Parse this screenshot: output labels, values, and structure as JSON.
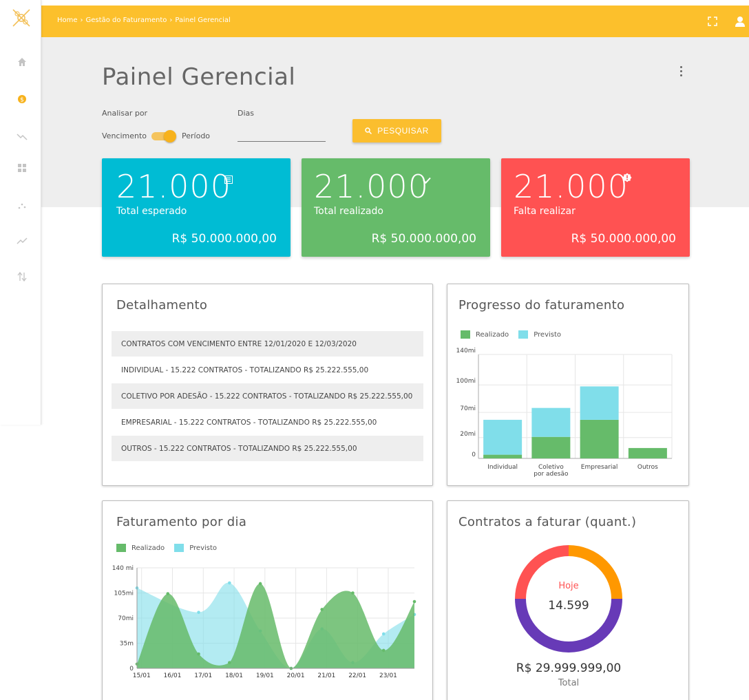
{
  "breadcrumb": [
    "Home",
    "Gestão do Faturamento",
    "Painel Gerencial"
  ],
  "page_title": "Painel Gerencial",
  "filters": {
    "analisar_label": "Analisar por",
    "dias_label": "Dias",
    "toggle_left": "Vencimento",
    "toggle_right": "Período",
    "toggle_on": true,
    "dias_value": "",
    "search_button": "PESQUISAR"
  },
  "stats": [
    {
      "value": "21.000",
      "label": "Total esperado",
      "amount": "R$ 50.000.000,00",
      "color": "#00bcd4",
      "icon": "list-icon"
    },
    {
      "value": "21.000",
      "label": "Total realizado",
      "amount": "R$ 50.000.000,00",
      "color": "#66bb6a",
      "icon": "check-icon"
    },
    {
      "value": "21.000",
      "label": "Falta realizar",
      "amount": "R$ 50.000.000,00",
      "color": "#ff5252",
      "icon": "alert-icon"
    }
  ],
  "detalhamento": {
    "title": "Detalhamento",
    "rows": [
      "CONTRATOS COM VENCIMENTO ENTRE 12/01/2020 E 12/03/2020",
      "INDIVIDUAL - 15.222 CONTRATOS  - TOTALIZANDO R$ 25.222.555,00",
      "COLETIVO POR ADESÃO  - 15.222 CONTRATOS  - TOTALIZANDO R$ 25.222.555,00",
      "EMPRESARIAL  - 15.222 CONTRATOS  - TOTALIZANDO R$ 25.222.555,00",
      "OUTROS  - 15.222 CONTRATOS  - TOTALIZANDO R$ 25.222.555,00"
    ]
  },
  "progresso": {
    "title": "Progresso do faturamento"
  },
  "faturamento_dia": {
    "title": "Faturamento por dia"
  },
  "contratos": {
    "title": "Contratos a faturar (quant.)",
    "center_label": "Hoje",
    "center_value": "14.599",
    "total_value": "R$ 29.999.999,00",
    "total_label": "Total"
  },
  "legend": {
    "realizado": "Realizado",
    "previsto": "Previsto"
  },
  "colors": {
    "realizado": "#66bb6a",
    "previsto": "#80deea",
    "accent": "#fcc02c"
  },
  "chart_data": [
    {
      "type": "bar",
      "stacked": true,
      "title": "Progresso do faturamento",
      "categories": [
        "Individual",
        "Coletivo\npor adesão",
        "Empresarial",
        "Outros"
      ],
      "series": [
        {
          "name": "Realizado",
          "color": "#66bb6a",
          "values": [
            5,
            29,
            52,
            14
          ]
        },
        {
          "name": "Previsto",
          "color": "#80deea",
          "values": [
            47,
            39,
            45,
            0
          ]
        }
      ],
      "yticks": [
        {
          "value": 0,
          "label": "0"
        },
        {
          "value": 28,
          "label": "20mi"
        },
        {
          "value": 62,
          "label": "70mi"
        },
        {
          "value": 99,
          "label": "100mi"
        },
        {
          "value": 140,
          "label": "140mi"
        }
      ],
      "ylim": [
        0,
        140
      ],
      "legend": "top-left",
      "grid": true
    },
    {
      "type": "area",
      "title": "Faturamento por dia",
      "x": [
        "15/01",
        "16/01",
        "17/01",
        "18/01",
        "19/01",
        "20/01",
        "21/01",
        "22/01",
        "23/01"
      ],
      "series": [
        {
          "name": "Realizado",
          "color": "#66bb6a",
          "x": [
            0,
            1,
            2,
            3,
            4,
            5,
            6,
            7,
            8,
            9
          ],
          "values": [
            6,
            104,
            20,
            8,
            118,
            0,
            82,
            105,
            25,
            93
          ]
        },
        {
          "name": "Previsto",
          "color": "#80deea",
          "x": [
            0,
            2,
            3,
            4,
            5,
            6,
            7,
            8,
            9
          ],
          "values": [
            112,
            78,
            119,
            52,
            0,
            55,
            8,
            48,
            75
          ]
        }
      ],
      "yticks": [
        {
          "value": 0,
          "label": "0"
        },
        {
          "value": 35,
          "label": "35m"
        },
        {
          "value": 70,
          "label": "70mi"
        },
        {
          "value": 105,
          "label": "105mi"
        },
        {
          "value": 140,
          "label": "140 mi"
        }
      ],
      "ylim": [
        0,
        140
      ],
      "legend": "top-left",
      "grid": true
    },
    {
      "type": "pie",
      "donut": true,
      "title": "Contratos a faturar (quant.)",
      "slices": [
        {
          "value": 25,
          "color": "#ff9800"
        },
        {
          "value": 50,
          "color": "#673ab7"
        },
        {
          "value": 25,
          "color": "#ff5252"
        }
      ]
    }
  ]
}
